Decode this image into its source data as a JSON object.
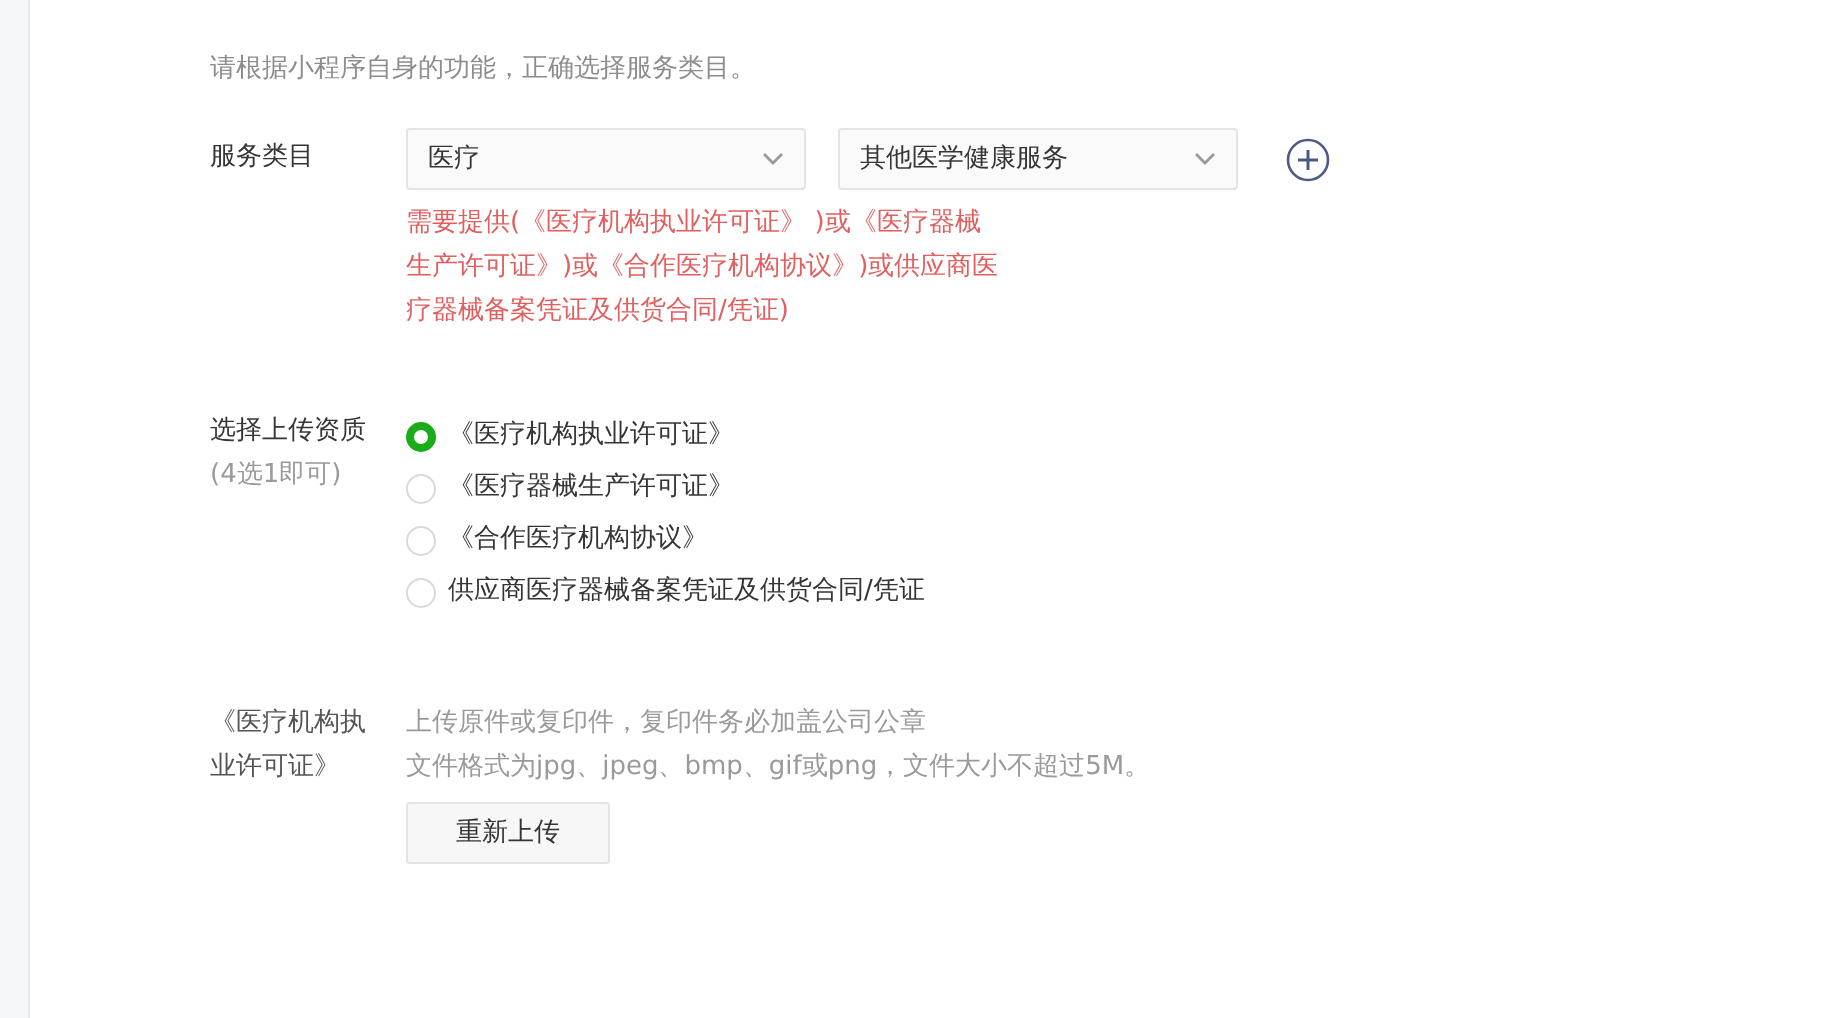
{
  "description": "请根据小程序自身的功能，正确选择服务类目。",
  "service_category": {
    "label": "服务类目",
    "selects": [
      {
        "value": "医疗"
      },
      {
        "value": "其他医学健康服务"
      }
    ],
    "note": "需要提供(《医疗机构执业许可证》 )或《医疗器械生产许可证》)或《合作医疗机构协议》)或供应商医疗器械备案凭证及供货合同/凭证)"
  },
  "qualification": {
    "label": "选择上传资质",
    "hint": "(4选1即可)",
    "options": [
      {
        "label": "《医疗机构执业许可证》",
        "selected": true
      },
      {
        "label": "《医疗器械生产许可证》",
        "selected": false
      },
      {
        "label": "《合作医疗机构协议》",
        "selected": false
      },
      {
        "label": "供应商医疗器械备案凭证及供货合同/凭证",
        "selected": false
      }
    ]
  },
  "upload": {
    "label": "《医疗机构执业许可证》",
    "hints": [
      "上传原件或复印件，复印件务必加盖公司公章",
      "文件格式为jpg、jpeg、bmp、gif或png，文件大小不超过5M。"
    ],
    "button": "重新上传"
  }
}
